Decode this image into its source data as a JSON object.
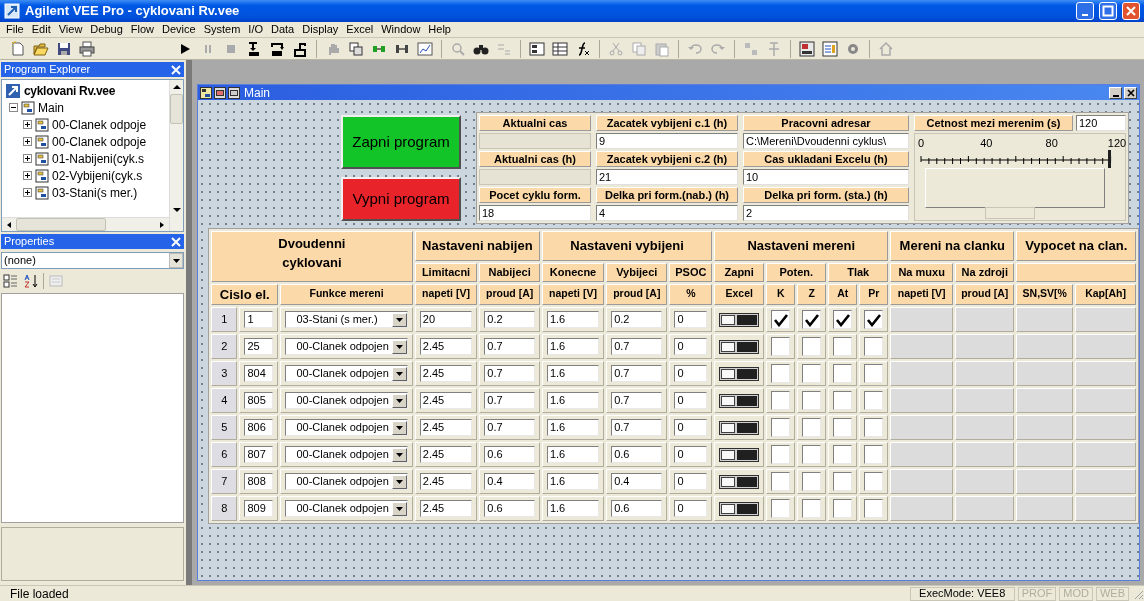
{
  "window": {
    "title": "Agilent VEE Pro - cyklovani Rv.vee"
  },
  "menu": [
    "File",
    "Edit",
    "View",
    "Debug",
    "Flow",
    "Device",
    "System",
    "I/O",
    "Data",
    "Display",
    "Excel",
    "Window",
    "Help"
  ],
  "program_explorer": {
    "title": "Program Explorer",
    "tree": [
      {
        "label": "cyklovani Rv.vee",
        "children": [
          {
            "label": "Main",
            "expanded": true,
            "children": [
              {
                "label": "00-Clanek odpoje",
                "expanded": false
              },
              {
                "label": "00-Clanek odpoje",
                "expanded": false
              },
              {
                "label": "01-Nabijeni(cyk.s",
                "expanded": false
              },
              {
                "label": "02-Vybijeni(cyk.s",
                "expanded": false
              },
              {
                "label": "03-Stani(s mer.)",
                "expanded": false
              }
            ]
          }
        ]
      }
    ]
  },
  "properties": {
    "title": "Properties",
    "selector": "(none)"
  },
  "main": {
    "title": "Main",
    "buttons": [
      {
        "label": "Zapni program",
        "kind": "start"
      },
      {
        "label": "Vypni program",
        "kind": "stop"
      }
    ],
    "fields": [
      {
        "label": "Aktualni cas",
        "kind": "display"
      },
      {
        "label": "Zacatek vybijeni c.1 (h)",
        "kind": "input",
        "value": "9"
      },
      {
        "label": "Pracovni adresar",
        "kind": "input",
        "value": "C:\\Mereni\\Dvoudenni cyklus\\"
      },
      {
        "label": "Aktualni cas (h)",
        "kind": "display"
      },
      {
        "label": "Zacatek vybijeni c.2 (h)",
        "kind": "input",
        "value": "21"
      },
      {
        "label": "Cas ukladani Excelu (h)",
        "kind": "input",
        "value": "10"
      },
      {
        "label": "Pocet cyklu form.",
        "kind": "input",
        "value": "18"
      },
      {
        "label": "Delka pri form.(nab.) (h)",
        "kind": "input",
        "value": "4"
      },
      {
        "label": "Delka pri form. (sta.) (h)",
        "kind": "input",
        "value": "2"
      }
    ],
    "interval": {
      "label": "Cetnost mezi merenim (s)",
      "value": "120",
      "scale": [
        "0",
        "40",
        "80",
        "120"
      ],
      "level": 1
    }
  },
  "table": {
    "group_headers": [
      "Dvoudenni cyklovani",
      "Nastaveni nabijen",
      "Nastaveni vybijeni",
      "Nastaveni mereni",
      "Mereni na clanku",
      "Vypocet na clan."
    ],
    "sub_headers": [
      "Limitacni",
      "Nabijeci",
      "Konecne",
      "Vybijeci",
      "PSOC",
      "Zapni",
      "Poten.",
      "Tlak",
      "Na muxu",
      "Na zdroji"
    ],
    "column_headers": [
      "Cislo el.",
      "Funkce mereni",
      "napeti [V]",
      "proud [A]",
      "napeti [V]",
      "proud [A]",
      "%",
      "Excel",
      "K",
      "Z",
      "At",
      "Pr",
      "napeti [V]",
      "proud [A]",
      "SN,SV[%",
      "Kap[Ah]"
    ],
    "rows": [
      {
        "number": "1",
        "cell_id": "1",
        "function": "03-Stani (s mer.)",
        "charge_voltage": "20",
        "charge_current": "0.2",
        "discharge_voltage": "1.6",
        "discharge_current": "0.2",
        "psoc": "0",
        "excel": false,
        "k": true,
        "z": true,
        "at": true,
        "pr": true
      },
      {
        "number": "2",
        "cell_id": "25",
        "function": "00-Clanek odpojen",
        "charge_voltage": "2.45",
        "charge_current": "0.7",
        "discharge_voltage": "1.6",
        "discharge_current": "0.7",
        "psoc": "0",
        "excel": false,
        "k": false,
        "z": false,
        "at": false,
        "pr": false
      },
      {
        "number": "3",
        "cell_id": "804",
        "function": "00-Clanek odpojen",
        "charge_voltage": "2.45",
        "charge_current": "0.7",
        "discharge_voltage": "1.6",
        "discharge_current": "0.7",
        "psoc": "0",
        "excel": false,
        "k": false,
        "z": false,
        "at": false,
        "pr": false
      },
      {
        "number": "4",
        "cell_id": "805",
        "function": "00-Clanek odpojen",
        "charge_voltage": "2.45",
        "charge_current": "0.7",
        "discharge_voltage": "1.6",
        "discharge_current": "0.7",
        "psoc": "0",
        "excel": false,
        "k": false,
        "z": false,
        "at": false,
        "pr": false
      },
      {
        "number": "5",
        "cell_id": "806",
        "function": "00-Clanek odpojen",
        "charge_voltage": "2.45",
        "charge_current": "0.7",
        "discharge_voltage": "1.6",
        "discharge_current": "0.7",
        "psoc": "0",
        "excel": false,
        "k": false,
        "z": false,
        "at": false,
        "pr": false
      },
      {
        "number": "6",
        "cell_id": "807",
        "function": "00-Clanek odpojen",
        "charge_voltage": "2.45",
        "charge_current": "0.6",
        "discharge_voltage": "1.6",
        "discharge_current": "0.6",
        "psoc": "0",
        "excel": false,
        "k": false,
        "z": false,
        "at": false,
        "pr": false
      },
      {
        "number": "7",
        "cell_id": "808",
        "function": "00-Clanek odpojen",
        "charge_voltage": "2.45",
        "charge_current": "0.4",
        "discharge_voltage": "1.6",
        "discharge_current": "0.4",
        "psoc": "0",
        "excel": false,
        "k": false,
        "z": false,
        "at": false,
        "pr": false
      },
      {
        "number": "8",
        "cell_id": "809",
        "function": "00-Clanek odpojen",
        "charge_voltage": "2.45",
        "charge_current": "0.6",
        "discharge_voltage": "1.6",
        "discharge_current": "0.6",
        "psoc": "0",
        "excel": false,
        "k": false,
        "z": false,
        "at": false,
        "pr": false
      }
    ]
  },
  "status_bar": {
    "message": "File loaded",
    "items": [
      {
        "label": "ExecMode: VEE8",
        "disabled": false
      },
      {
        "label": "PROF",
        "disabled": true
      },
      {
        "label": "MOD",
        "disabled": true
      },
      {
        "label": "WEB",
        "disabled": true
      }
    ]
  }
}
